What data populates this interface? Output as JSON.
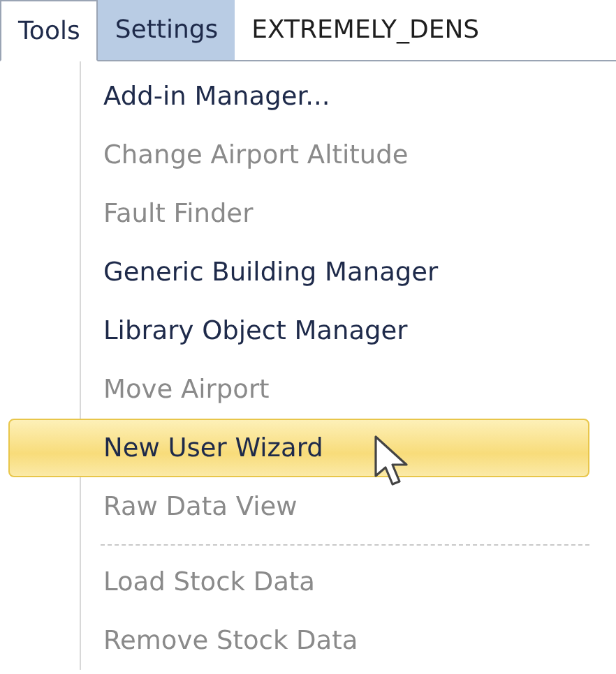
{
  "tabs": [
    {
      "label": "Tools",
      "selected": true,
      "hovered": false
    },
    {
      "label": "Settings",
      "selected": false,
      "hovered": true
    },
    {
      "label": "EXTREMELY_DENS",
      "selected": false,
      "hovered": false
    }
  ],
  "menu": {
    "items": [
      {
        "kind": "command",
        "label": "Add-in Manager...",
        "disabled": false,
        "selected": false
      },
      {
        "kind": "command",
        "label": "Change Airport Altitude",
        "disabled": true,
        "selected": false
      },
      {
        "kind": "command",
        "label": "Fault Finder",
        "disabled": true,
        "selected": false
      },
      {
        "kind": "command",
        "label": "Generic Building Manager",
        "disabled": false,
        "selected": false
      },
      {
        "kind": "command",
        "label": "Library Object Manager",
        "disabled": false,
        "selected": false
      },
      {
        "kind": "command",
        "label": "Move Airport",
        "disabled": true,
        "selected": false
      },
      {
        "kind": "command",
        "label": "New User Wizard",
        "disabled": false,
        "selected": true
      },
      {
        "kind": "command",
        "label": "Raw Data View",
        "disabled": true,
        "selected": false
      },
      {
        "kind": "separator"
      },
      {
        "kind": "command",
        "label": "Load Stock Data",
        "disabled": true,
        "selected": false
      },
      {
        "kind": "command",
        "label": "Remove Stock Data",
        "disabled": true,
        "selected": false
      }
    ]
  }
}
